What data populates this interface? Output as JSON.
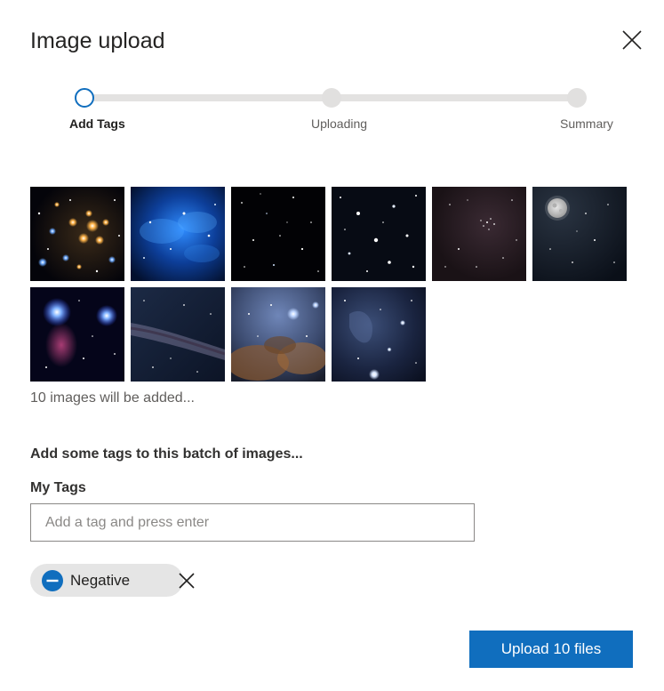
{
  "dialog": {
    "title": "Image upload",
    "close_icon": "close-icon"
  },
  "stepper": {
    "steps": [
      {
        "label": "Add Tags",
        "state": "active"
      },
      {
        "label": "Uploading",
        "state": "pending"
      },
      {
        "label": "Summary",
        "state": "pending"
      }
    ]
  },
  "images": {
    "thumbnails": [
      {
        "subject": "star cluster",
        "icon": "star-cluster-image"
      },
      {
        "subject": "blue nebula",
        "icon": "blue-nebula-image"
      },
      {
        "subject": "dark starfield",
        "icon": "dark-starfield-image"
      },
      {
        "subject": "starfield",
        "icon": "starfield-image"
      },
      {
        "subject": "dense starfield",
        "icon": "dense-starfield-image"
      },
      {
        "subject": "moon over stars",
        "icon": "moon-image"
      },
      {
        "subject": "blue stars nebula",
        "icon": "blue-stars-image"
      },
      {
        "subject": "milky way",
        "icon": "milky-way-image"
      },
      {
        "subject": "brown nebula",
        "icon": "brown-nebula-image"
      },
      {
        "subject": "deep space nebula",
        "icon": "deep-space-image"
      }
    ],
    "count_text": "10 images will be added..."
  },
  "tags": {
    "heading": "Add some tags to this batch of images...",
    "field_label": "My Tags",
    "input_value": "",
    "input_placeholder": "Add a tag and press enter",
    "chips": [
      {
        "label": "Negative",
        "icon": "minus-circle-icon",
        "remove_icon": "close-icon"
      }
    ]
  },
  "footer": {
    "upload_label": "Upload 10 files"
  },
  "colors": {
    "accent": "#106ebe",
    "track": "#e3e2e1",
    "chip_bg": "#e5e5e5"
  }
}
